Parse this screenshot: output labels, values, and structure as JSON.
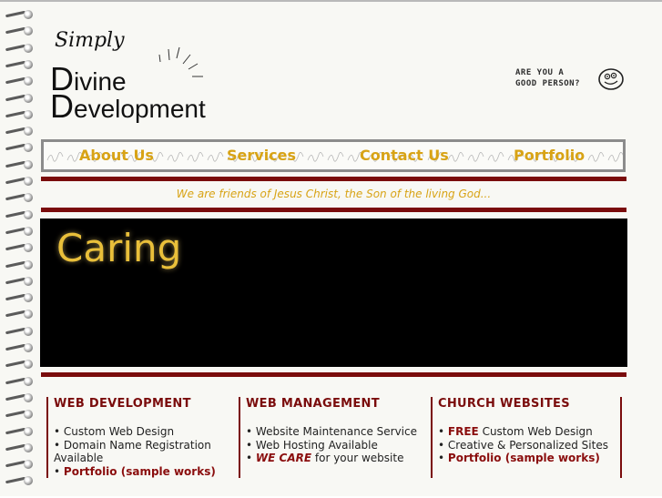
{
  "logo": {
    "line1": "Simply",
    "line2_cap": "D",
    "line2_rest": "ivine",
    "line3_cap": "D",
    "line3_rest": "evelopment"
  },
  "good_person": {
    "line1": "ARE YOU A",
    "line2": "GOOD PERSON?",
    "icon": "smiley-face-icon"
  },
  "nav": {
    "items": [
      "About Us",
      "Services",
      "Contact Us",
      "Portfolio"
    ]
  },
  "tagline": "We are friends of Jesus Christ, the Son of the living God...",
  "banner": {
    "word": "Caring"
  },
  "columns": [
    {
      "title": "WEB DEVELOPMENT",
      "items": [
        {
          "bullet": "•",
          "text": "Custom Web Design"
        },
        {
          "bullet": "•",
          "text": "Domain Name Registration Available"
        },
        {
          "bullet": "•",
          "link": "Portfolio (sample works)"
        }
      ]
    },
    {
      "title": "WEB MANAGEMENT",
      "items": [
        {
          "bullet": "•",
          "text": "Website Maintenance Service"
        },
        {
          "bullet": "•",
          "text": "Web Hosting Available"
        },
        {
          "bullet": "•",
          "emph": "WE CARE",
          "text": " for your website"
        }
      ]
    },
    {
      "title": "CHURCH WEBSITES",
      "items": [
        {
          "bullet": "•",
          "emph": "FREE",
          "text": " Custom Web Design"
        },
        {
          "bullet": "•",
          "text": "Creative & Personalized Sites"
        },
        {
          "bullet": "•",
          "link": "Portfolio (sample works)"
        }
      ]
    }
  ],
  "colors": {
    "accent_gold": "#d8a315",
    "accent_red": "#7a0c0c",
    "banner_bg": "#000000"
  }
}
